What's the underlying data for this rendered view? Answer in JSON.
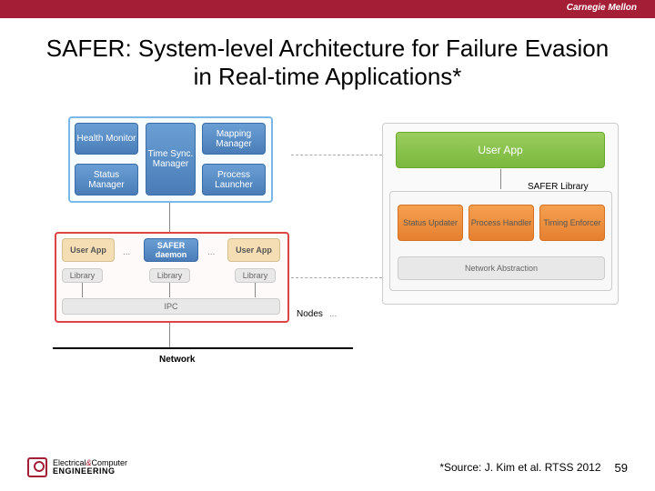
{
  "header": {
    "logo": "Carnegie Mellon"
  },
  "title": "SAFER: System-level Architecture for Failure Evasion in Real-time Applications*",
  "diagram": {
    "master": {
      "health_monitor": "Health Monitor",
      "status_manager": "Status Manager",
      "time_sync": "Time Sync. Manager",
      "mapping_manager": "Mapping Manager",
      "process_launcher": "Process Launcher"
    },
    "node": {
      "user_app_left": "User App",
      "safer_daemon": "SAFER daemon",
      "user_app_right": "User App",
      "library_left": "Library",
      "library_mid": "Library",
      "library_right": "Library",
      "ipc": "IPC",
      "nodes_label": "Nodes"
    },
    "right": {
      "user_app": "User App",
      "safer_lib": "SAFER Library",
      "status_updater": "Status Updater",
      "process_handler": "Process Handler",
      "timing_enforcer": "Timing Enforcer",
      "network_abstraction": "Network Abstraction"
    },
    "network": "Network"
  },
  "footer": {
    "dept1": "Electrical",
    "dept_amp": "&",
    "dept2": "Computer",
    "eng": "ENGINEERING",
    "source": "*Source: J. Kim et al. RTSS 2012",
    "page": "59"
  }
}
